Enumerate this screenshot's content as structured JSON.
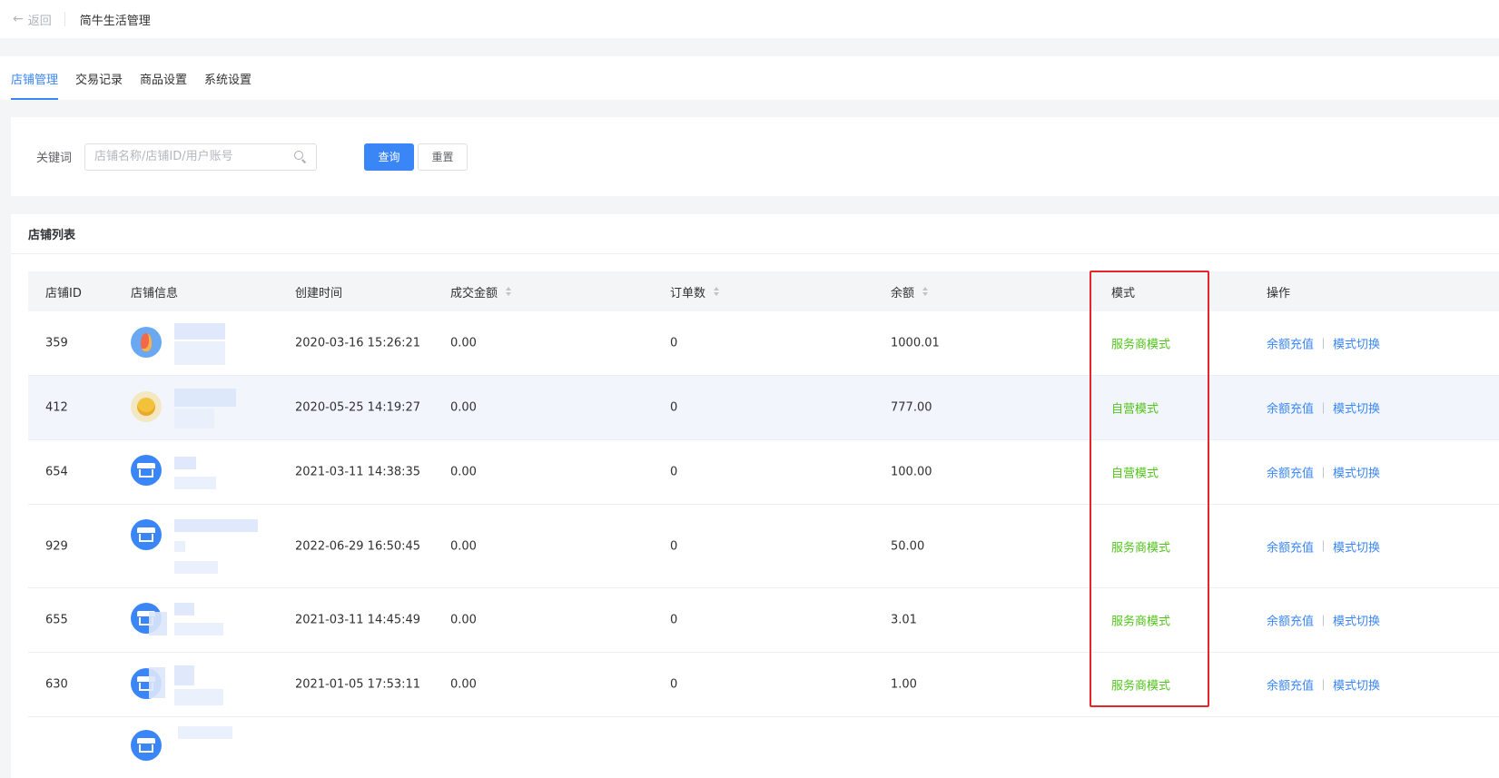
{
  "header": {
    "back_label": "返回",
    "app_title": "简牛生活管理"
  },
  "tabs": [
    {
      "label": "店铺管理",
      "active": true
    },
    {
      "label": "交易记录",
      "active": false
    },
    {
      "label": "商品设置",
      "active": false
    },
    {
      "label": "系统设置",
      "active": false
    }
  ],
  "search": {
    "keyword_label": "关键词",
    "placeholder": "店铺名称/店铺ID/用户账号",
    "value": "",
    "query_label": "查询",
    "reset_label": "重置"
  },
  "list": {
    "title": "店铺列表",
    "columns": {
      "id": "店铺ID",
      "info": "店铺信息",
      "created": "创建时间",
      "amount": "成交金额",
      "orders": "订单数",
      "balance": "余额",
      "mode": "模式",
      "ops": "操作"
    },
    "op_recharge": "余额充值",
    "op_switch": "模式切换",
    "rows": [
      {
        "id": "359",
        "avatar": "flame-avatar",
        "created": "2020-03-16 15:26:21",
        "amount": "0.00",
        "orders": "0",
        "balance": "1000.01",
        "mode": "服务商模式"
      },
      {
        "id": "412",
        "avatar": "smile-avatar",
        "created": "2020-05-25 14:19:27",
        "amount": "0.00",
        "orders": "0",
        "balance": "777.00",
        "mode": "自营模式"
      },
      {
        "id": "654",
        "avatar": "shop-avatar",
        "created": "2021-03-11 14:38:35",
        "amount": "0.00",
        "orders": "0",
        "balance": "100.00",
        "mode": "自营模式"
      },
      {
        "id": "929",
        "avatar": "shop-avatar",
        "created": "2022-06-29 16:50:45",
        "amount": "0.00",
        "orders": "0",
        "balance": "50.00",
        "mode": "服务商模式"
      },
      {
        "id": "655",
        "avatar": "shop-avatar",
        "created": "2021-03-11 14:45:49",
        "amount": "0.00",
        "orders": "0",
        "balance": "3.01",
        "mode": "服务商模式"
      },
      {
        "id": "630",
        "avatar": "shop-avatar",
        "created": "2021-01-05 17:53:11",
        "amount": "0.00",
        "orders": "0",
        "balance": "1.00",
        "mode": "服务商模式"
      }
    ]
  },
  "colors": {
    "primary": "#3a86f7",
    "mode_text": "#52c41a",
    "highlight_box": "#e8232a"
  }
}
